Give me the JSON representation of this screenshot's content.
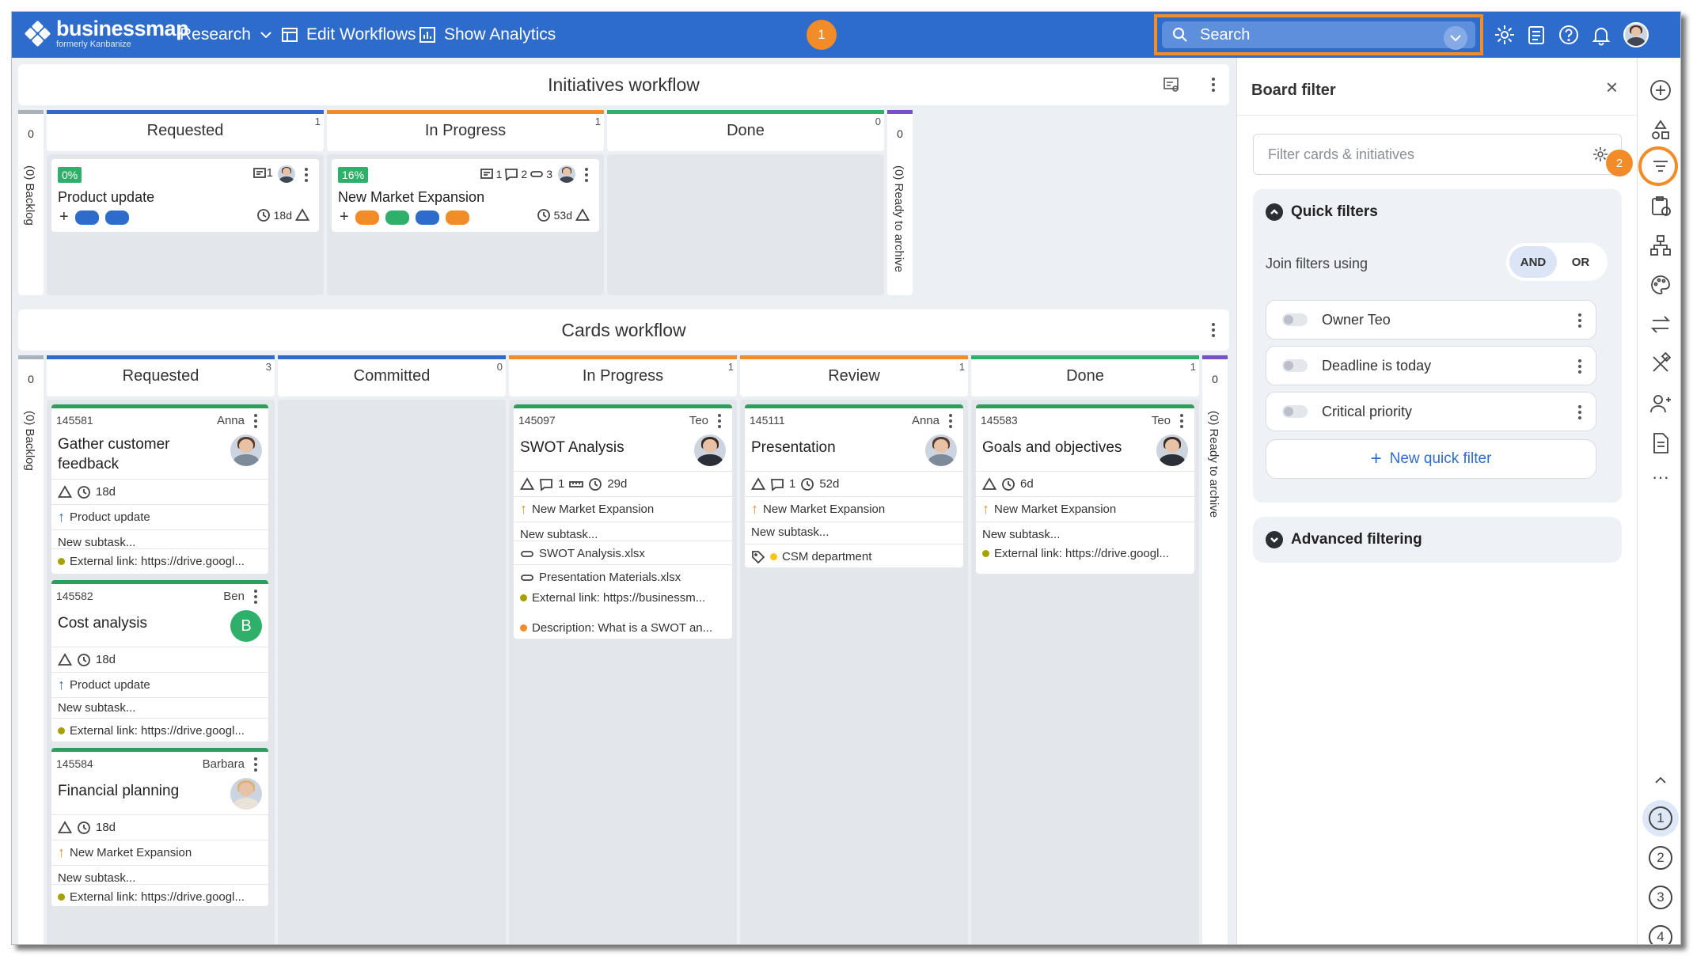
{
  "topbar": {
    "brand": "businessmap",
    "brand_sub": "formerly Kanbanize",
    "workspace": "Research",
    "edit_workflows": "Edit Workflows",
    "show_analytics": "Show Analytics",
    "search_placeholder": "Search",
    "step_badge_1": "1",
    "step_badge_2": "2"
  },
  "initiatives": {
    "title": "Initiatives workflow",
    "backlog_count": "0",
    "backlog_label": "(0) Backlog",
    "archive_count": "0",
    "archive_label": "(0) Ready to archive",
    "columns": [
      {
        "name": "Requested",
        "count": "1",
        "color": "#2e6ccc"
      },
      {
        "name": "In Progress",
        "count": "1",
        "color": "#f28c28"
      },
      {
        "name": "Done",
        "count": "0",
        "color": "#2eaf6a"
      }
    ],
    "cards": [
      {
        "progress": "0%",
        "comments": "1",
        "title": "Product update",
        "age": "18d"
      },
      {
        "progress": "16%",
        "comments": "1",
        "subtasks": "2",
        "links": "3",
        "title": "New Market Expansion",
        "age": "53d"
      }
    ]
  },
  "cards_workflow": {
    "title": "Cards workflow",
    "backlog_count": "0",
    "backlog_label": "(0) Backlog",
    "archive_count": "0",
    "archive_label": "(0) Ready to archive",
    "columns": [
      {
        "name": "Requested",
        "count": "3",
        "color": "#2e6ccc"
      },
      {
        "name": "Committed",
        "count": "0",
        "color": "#2e6ccc"
      },
      {
        "name": "In Progress",
        "count": "1",
        "color": "#f28c28"
      },
      {
        "name": "Review",
        "count": "1",
        "color": "#f28c28"
      },
      {
        "name": "Done",
        "count": "1",
        "color": "#2eaf6a"
      }
    ],
    "cards": [
      {
        "id": "145581",
        "owner": "Anna",
        "title_line1": "Gather customer",
        "title_line2": "feedback",
        "age": "18d",
        "parent": "Product update",
        "subtask": "New subtask...",
        "link": "External link: https://drive.googl..."
      },
      {
        "id": "145582",
        "owner": "Ben",
        "avatar_letter": "B",
        "title": "Cost analysis",
        "age": "18d",
        "parent": "Product update",
        "subtask": "New subtask...",
        "link": "External link: https://drive.googl..."
      },
      {
        "id": "145584",
        "owner": "Barbara",
        "title": "Financial planning",
        "age": "18d",
        "parent": "New Market Expansion",
        "subtask": "New subtask...",
        "link": "External link: https://drive.googl..."
      },
      {
        "id": "145097",
        "owner": "Teo",
        "title": "SWOT Analysis",
        "comments": "1",
        "age": "29d",
        "parent": "New Market Expansion",
        "subtask": "New subtask...",
        "file1": "SWOT Analysis.xlsx",
        "file2": "Presentation Materials.xlsx",
        "link": "External link: https://businessm...",
        "desc": "Description: What is a SWOT an..."
      },
      {
        "id": "145111",
        "owner": "Anna",
        "title": "Presentation",
        "comments": "1",
        "age": "52d",
        "parent": "New Market Expansion",
        "subtask": "New subtask...",
        "tag": "CSM department"
      },
      {
        "id": "145583",
        "owner": "Teo",
        "title": "Goals and objectives",
        "age": "6d",
        "parent": "New Market Expansion",
        "subtask": "New subtask...",
        "link": "External link: https://drive.googl..."
      }
    ]
  },
  "filter_panel": {
    "title": "Board filter",
    "input_placeholder": "Filter cards & initiatives",
    "quick_filters": "Quick filters",
    "join_label": "Join filters using",
    "and": "AND",
    "or": "OR",
    "items": [
      "Owner Teo",
      "Deadline is today",
      "Critical priority"
    ],
    "new_quick_filter": "New quick filter",
    "advanced": "Advanced filtering"
  },
  "rail": {
    "n1": "1",
    "n2": "2",
    "n3": "3",
    "n4": "4"
  },
  "colors": {
    "brand": "#2e6ccc",
    "accent": "#f28c28",
    "done": "#2eaf6a"
  }
}
